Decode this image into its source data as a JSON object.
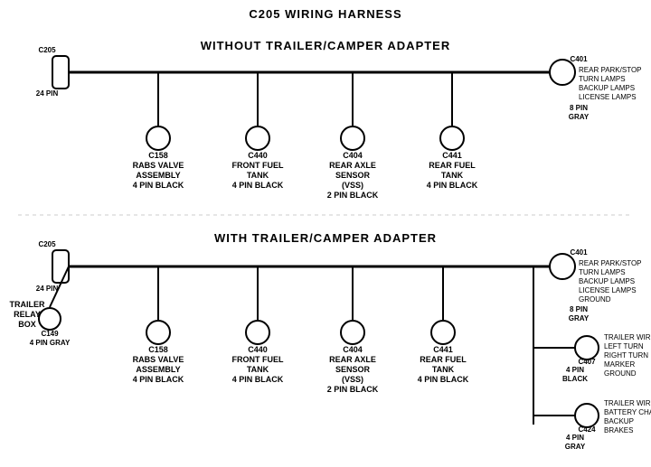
{
  "title": "C205 WIRING HARNESS",
  "top_section": {
    "label": "WITHOUT TRAILER/CAMPER ADAPTER",
    "left_connector": {
      "id": "C205",
      "pin": "24 PIN"
    },
    "right_connector": {
      "id": "C401",
      "pin": "8 PIN",
      "color": "GRAY",
      "desc": "REAR PARK/STOP\nTURN LAMPS\nBACKUP LAMPS\nLICENSE LAMPS"
    },
    "connectors": [
      {
        "id": "C158",
        "desc": "RABS VALVE\nASSEMBLY\n4 PIN BLACK"
      },
      {
        "id": "C440",
        "desc": "FRONT FUEL\nTANK\n4 PIN BLACK"
      },
      {
        "id": "C404",
        "desc": "REAR AXLE\nSENSOR\n(VSS)\n2 PIN BLACK"
      },
      {
        "id": "C441",
        "desc": "REAR FUEL\nTANK\n4 PIN BLACK"
      }
    ]
  },
  "bottom_section": {
    "label": "WITH TRAILER/CAMPER ADAPTER",
    "left_connector": {
      "id": "C205",
      "pin": "24 PIN"
    },
    "right_connector": {
      "id": "C401",
      "pin": "8 PIN",
      "color": "GRAY",
      "desc": "REAR PARK/STOP\nTURN LAMPS\nBACKUP LAMPS\nLICENSE LAMPS\nGROUND"
    },
    "extra_left": {
      "id": "C149",
      "pin": "4 PIN GRAY",
      "label": "TRAILER\nRELAY\nBOX"
    },
    "connectors": [
      {
        "id": "C158",
        "desc": "RABS VALVE\nASSEMBLY\n4 PIN BLACK"
      },
      {
        "id": "C440",
        "desc": "FRONT FUEL\nTANK\n4 PIN BLACK"
      },
      {
        "id": "C404",
        "desc": "REAR AXLE\nSENSOR\n(VSS)\n2 PIN BLACK"
      },
      {
        "id": "C441",
        "desc": "REAR FUEL\nTANK\n4 PIN BLACK"
      }
    ],
    "right_extra": [
      {
        "id": "C407",
        "pin": "4 PIN\nBLACK",
        "desc": "TRAILER WIRES\nLEFT TURN\nRIGHT TURN\nMARKER\nGROUND"
      },
      {
        "id": "C424",
        "pin": "4 PIN\nGRAY",
        "desc": "TRAILER WIRES\nBATTERY CHARGE\nBACKUP\nBRAKES"
      }
    ]
  }
}
